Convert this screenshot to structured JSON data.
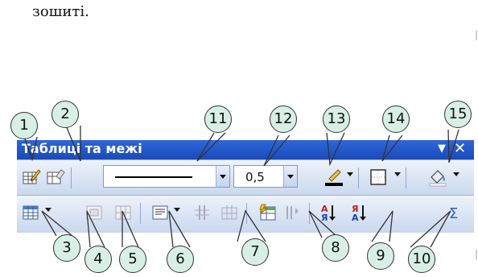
{
  "page": {
    "top_text": "зошиті."
  },
  "toolbar": {
    "title": "Таблиці та межі",
    "line_style_value": "",
    "line_weight_value": "0,5",
    "icons_row1": [
      "draw-table-icon",
      "eraser-icon",
      "line-style-combo",
      "line-weight-combo",
      "border-color-icon",
      "outside-border-icon",
      "shading-color-icon"
    ],
    "icons_row2": [
      "insert-table-icon",
      "merge-cells-icon",
      "split-cells-icon",
      "align-icon",
      "distribute-rows-icon",
      "distribute-columns-icon",
      "table-autoformat-icon",
      "change-text-direction-icon",
      "sort-ascending-icon",
      "sort-descending-icon",
      "autosum-icon"
    ]
  },
  "callouts": {
    "c1": "1",
    "c2": "2",
    "c3": "3",
    "c4": "4",
    "c5": "5",
    "c6": "6",
    "c7": "7",
    "c8": "8",
    "c9": "9",
    "c10": "10",
    "c11": "11",
    "c12": "12",
    "c13": "13",
    "c14": "14",
    "c15": "15"
  }
}
